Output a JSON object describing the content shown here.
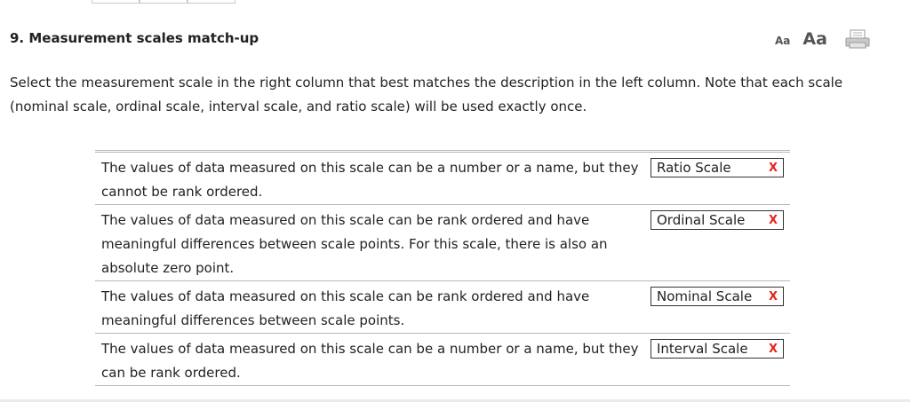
{
  "question": {
    "title": "9. Measurement scales match-up",
    "instructions": "Select the measurement scale in the right column that best matches the description in the left column. Note that each scale (nominal scale, ordinal scale, interval scale, and ratio scale) will be used exactly once."
  },
  "font_controls": {
    "small_label": "Aa",
    "large_label": "Aa"
  },
  "icons": {
    "print": "print-icon",
    "incorrect": "x-mark-icon"
  },
  "colors": {
    "incorrect": "#e8231a",
    "border": "#b9b9b9"
  },
  "rows": [
    {
      "description": "The values of data measured on this scale can be a number or a name, but they cannot be rank ordered.",
      "answer": "Ratio Scale",
      "mark": "X"
    },
    {
      "description": "The values of data measured on this scale can be rank ordered and have meaningful differences between scale points. For this scale, there is also an absolute zero point.",
      "answer": "Ordinal Scale",
      "mark": "X"
    },
    {
      "description": "The values of data measured on this scale can be rank ordered and have meaningful differences between scale points.",
      "answer": "Nominal Scale",
      "mark": "X"
    },
    {
      "description": "The values of data measured on this scale can be a number or a name, but they can be rank ordered.",
      "answer": "Interval Scale",
      "mark": "X"
    }
  ]
}
